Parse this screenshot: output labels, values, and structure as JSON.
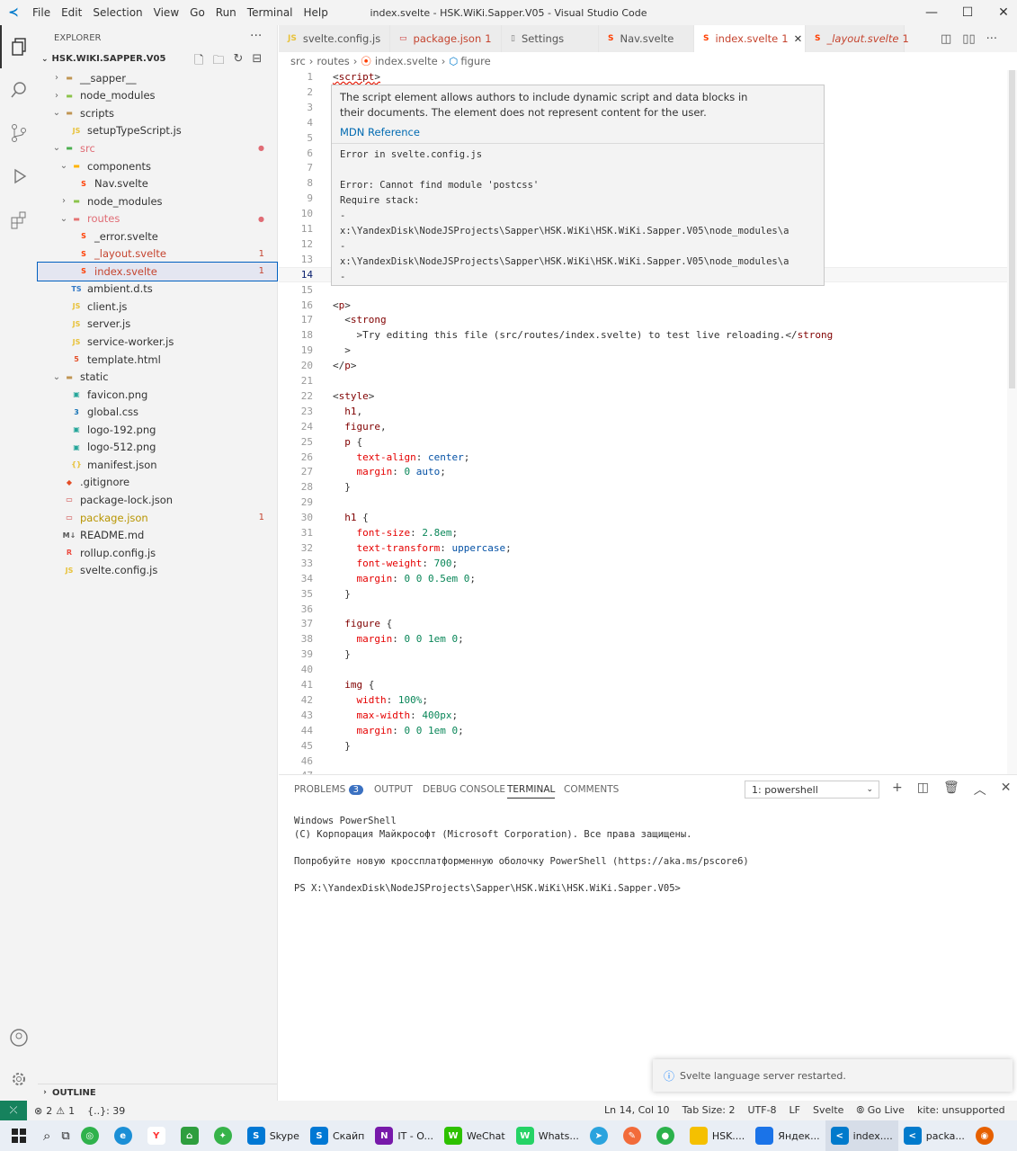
{
  "window": {
    "title": "index.svelte - HSK.WiKi.Sapper.V05 - Visual Studio Code"
  },
  "menu": [
    "File",
    "Edit",
    "Selection",
    "View",
    "Go",
    "Run",
    "Terminal",
    "Help"
  ],
  "sidebar": {
    "header": "EXPLORER",
    "project": "HSK.WIKI.SAPPER.V05",
    "items": [
      {
        "label": "__sapper__",
        "icon": "folder-icon",
        "badge": ""
      },
      {
        "label": "node_modules",
        "icon": "folder-node-icon",
        "badge": ""
      },
      {
        "label": "scripts",
        "icon": "folder-icon",
        "badge": ""
      },
      {
        "label": "setupTypeScript.js",
        "icon": "js-file-icon",
        "badge": ""
      },
      {
        "label": "src",
        "icon": "folder-src-icon",
        "badge": "dot"
      },
      {
        "label": "components",
        "icon": "folder-components-icon",
        "badge": ""
      },
      {
        "label": "Nav.svelte",
        "icon": "svelte-file-icon",
        "badge": ""
      },
      {
        "label": "node_modules",
        "icon": "folder-node-icon",
        "badge": ""
      },
      {
        "label": "routes",
        "icon": "folder-routes-icon",
        "badge": "dot"
      },
      {
        "label": "_error.svelte",
        "icon": "svelte-file-icon",
        "badge": ""
      },
      {
        "label": "_layout.svelte",
        "icon": "svelte-file-icon",
        "badge": "1"
      },
      {
        "label": "index.svelte",
        "icon": "svelte-file-icon",
        "badge": "1"
      },
      {
        "label": "ambient.d.ts",
        "icon": "ts-file-icon",
        "badge": ""
      },
      {
        "label": "client.js",
        "icon": "js-file-icon",
        "badge": ""
      },
      {
        "label": "server.js",
        "icon": "js-file-icon",
        "badge": ""
      },
      {
        "label": "service-worker.js",
        "icon": "js-file-icon",
        "badge": ""
      },
      {
        "label": "template.html",
        "icon": "html-file-icon",
        "badge": ""
      },
      {
        "label": "static",
        "icon": "folder-icon",
        "badge": ""
      },
      {
        "label": "favicon.png",
        "icon": "image-file-icon",
        "badge": ""
      },
      {
        "label": "global.css",
        "icon": "css-file-icon",
        "badge": ""
      },
      {
        "label": "logo-192.png",
        "icon": "image-file-icon",
        "badge": ""
      },
      {
        "label": "logo-512.png",
        "icon": "image-file-icon",
        "badge": ""
      },
      {
        "label": "manifest.json",
        "icon": "json-file-icon",
        "badge": ""
      },
      {
        "label": ".gitignore",
        "icon": "git-file-icon",
        "badge": ""
      },
      {
        "label": "package-lock.json",
        "icon": "npm-file-icon",
        "badge": ""
      },
      {
        "label": "package.json",
        "icon": "npm-file-icon",
        "badge": "1"
      },
      {
        "label": "README.md",
        "icon": "markdown-file-icon",
        "badge": ""
      },
      {
        "label": "rollup.config.js",
        "icon": "rollup-file-icon",
        "badge": ""
      },
      {
        "label": "svelte.config.js",
        "icon": "js-file-icon",
        "badge": ""
      }
    ],
    "outline": "OUTLINE"
  },
  "tabs": [
    {
      "label": "svelte.config.js",
      "badge": ""
    },
    {
      "label": "package.json",
      "badge": "1"
    },
    {
      "label": "Settings",
      "badge": ""
    },
    {
      "label": "Nav.svelte",
      "badge": ""
    },
    {
      "label": "index.svelte",
      "badge": "1"
    },
    {
      "label": "_layout.svelte",
      "badge": "1"
    }
  ],
  "breadcrumb": [
    "src",
    "routes",
    "index.svelte",
    "figure"
  ],
  "hover": {
    "description_1": "The script element allows authors to include dynamic script and data blocks in",
    "description_2": "their documents. The element does not represent content for the user.",
    "link": "MDN Reference",
    "error_lines": [
      "Error in svelte.config.js",
      "",
      "Error: Cannot find module 'postcss'",
      "Require stack:",
      "-",
      "x:\\YandexDisk\\NodeJSProjects\\Sapper\\HSK.WiKi\\HSK.WiKi.Sapper.V05\\node_modules\\a",
      "-",
      "x:\\YandexDisk\\NodeJSProjects\\Sapper\\HSK.WiKi\\HSK.WiKi.Sapper.V05\\node_modules\\a",
      "-"
    ]
  },
  "code": [
    "<script>",
    "",
    "",
    "",
    "",
    "",
    "",
    "",
    "",
    "",
    "",
    "",
    "",
    "",
    "",
    "<p>",
    "  <strong",
    "    >Try editing this file (src/routes/index.svelte) to test live reloading.</strong",
    "  >",
    "</p>",
    "",
    "<style>",
    "  h1,",
    "  figure,",
    "  p {",
    "    text-align: center;",
    "    margin: 0 auto;",
    "  }",
    "",
    "  h1 {",
    "    font-size: 2.8em;",
    "    text-transform: uppercase;",
    "    font-weight: 700;",
    "    margin: 0 0 0.5em 0;",
    "  }",
    "",
    "  figure {",
    "    margin: 0 0 1em 0;",
    "  }",
    "",
    "  img {",
    "    width: 100%;",
    "    max-width: 400px;",
    "    margin: 0 0 1em 0;",
    "  }",
    ""
  ],
  "panel": {
    "tabs": [
      "PROBLEMS",
      "OUTPUT",
      "DEBUG CONSOLE",
      "TERMINAL",
      "COMMENTS"
    ],
    "problems_count": "3",
    "terminal_select": "1: powershell",
    "terminal_lines": [
      "Windows PowerShell",
      "(C) Корпорация Майкрософт (Microsoft Corporation). Все права защищены.",
      "",
      "Попробуйте новую кроссплатформенную оболочку PowerShell (https://aka.ms/pscore6)",
      "",
      "PS X:\\YandexDisk\\NodeJSProjects\\Sapper\\HSK.WiKi\\HSK.WiKi.Sapper.V05>"
    ]
  },
  "toast": "Svelte language server restarted.",
  "status": {
    "errors": "2",
    "warnings": "1",
    "braces": "{..}: 39",
    "position": "Ln 14, Col 10",
    "tab_size": "Tab Size: 2",
    "encoding": "UTF-8",
    "eol": "LF",
    "language": "Svelte",
    "golive": "Go Live",
    "kite": "kite: unsupported"
  },
  "taskbar": [
    {
      "label": "Skype",
      "color": "#0078d4",
      "glyph": "S"
    },
    {
      "label": "Скайп",
      "color": "#0078d4",
      "glyph": "S"
    },
    {
      "label": "IT - O...",
      "color": "#7719aa",
      "glyph": "N"
    },
    {
      "label": "WeChat",
      "color": "#2dc100",
      "glyph": "W"
    },
    {
      "label": "Whats...",
      "color": "#25d366",
      "glyph": "W"
    },
    {
      "label": "HSK....",
      "color": "#f5c000",
      "glyph": ""
    },
    {
      "label": "Яндек...",
      "color": "#1a73e8",
      "glyph": ""
    },
    {
      "label": "index....",
      "color": "#007acc",
      "glyph": "<"
    },
    {
      "label": "packa...",
      "color": "#007acc",
      "glyph": "<"
    }
  ]
}
